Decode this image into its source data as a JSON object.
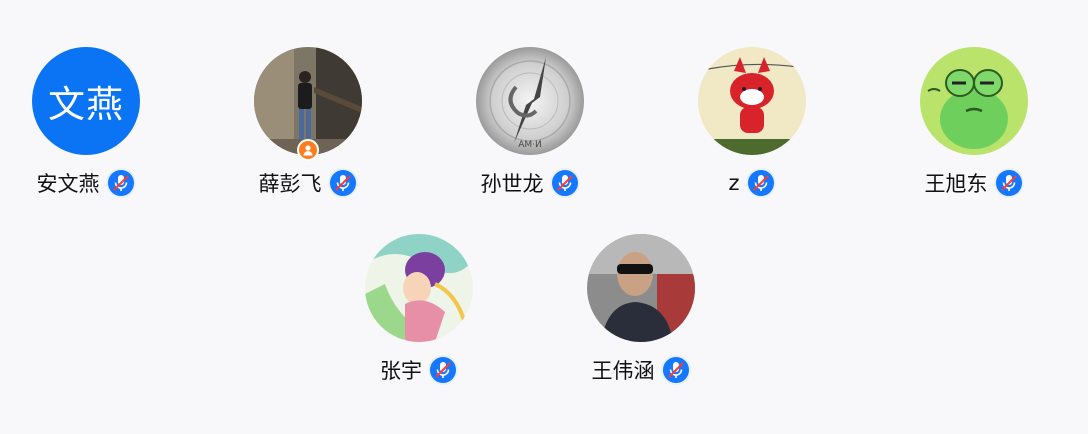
{
  "participants": [
    {
      "name": "安文燕",
      "avatar_text": "文燕",
      "avatar_color": "#0a74f5",
      "mic": "muted-mic-icon"
    },
    {
      "name": "薛彭飞",
      "avatar": "photo-person-mountain",
      "host_badge": "person-icon",
      "mic": "muted-mic-icon"
    },
    {
      "name": "孙世龙",
      "avatar": "gray-compass-art",
      "mic": "muted-mic-icon"
    },
    {
      "name": "z",
      "avatar": "red-fox-cartoon",
      "mic": "muted-mic-icon"
    },
    {
      "name": "王旭东",
      "avatar": "green-frog-cartoon",
      "mic": "muted-mic-icon"
    },
    {
      "name": "张宇",
      "avatar": "anime-illustration",
      "mic": "muted-mic-icon"
    },
    {
      "name": "王伟涵",
      "avatar": "photo-man-sunglasses",
      "mic": "muted-mic-icon"
    }
  ],
  "colors": {
    "mic_bg": "#1677ff",
    "mute_slash": "#ff3b30",
    "host_badge": "#ff7d1e",
    "background": "#f8f8fa"
  }
}
